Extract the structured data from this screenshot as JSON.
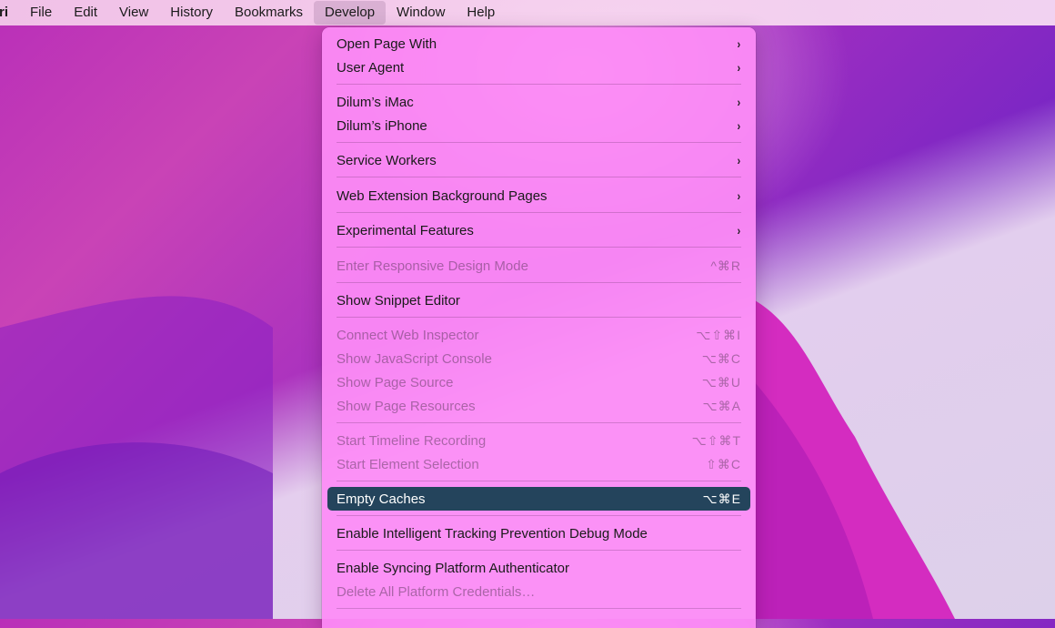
{
  "menubar": {
    "items": [
      "ri",
      "File",
      "Edit",
      "View",
      "History",
      "Bookmarks",
      "Develop",
      "Window",
      "Help"
    ]
  },
  "menu": {
    "items": {
      "open_page_with": {
        "label": "Open Page With",
        "shortcut": "›"
      },
      "user_agent": {
        "label": "User Agent",
        "shortcut": "›"
      },
      "imac": {
        "label": "Dilum’s iMac",
        "shortcut": "›"
      },
      "iphone": {
        "label": "Dilum’s iPhone",
        "shortcut": "›"
      },
      "service_workers": {
        "label": "Service Workers",
        "shortcut": "›"
      },
      "web_ext_bg": {
        "label": "Web Extension Background Pages",
        "shortcut": "›"
      },
      "experimental": {
        "label": "Experimental Features",
        "shortcut": "›"
      },
      "responsive": {
        "label": "Enter Responsive Design Mode",
        "shortcut": "^⌘R"
      },
      "snippet": {
        "label": "Show Snippet Editor",
        "shortcut": ""
      },
      "connect_inspector": {
        "label": "Connect Web Inspector",
        "shortcut": "⌥⇧⌘I"
      },
      "js_console": {
        "label": "Show JavaScript Console",
        "shortcut": "⌥⌘C"
      },
      "page_source": {
        "label": "Show Page Source",
        "shortcut": "⌥⌘U"
      },
      "page_resources": {
        "label": "Show Page Resources",
        "shortcut": "⌥⌘A"
      },
      "timeline": {
        "label": "Start Timeline Recording",
        "shortcut": "⌥⇧⌘T"
      },
      "element_selection": {
        "label": "Start Element Selection",
        "shortcut": "⇧⌘C"
      },
      "empty_caches": {
        "label": "Empty Caches",
        "shortcut": "⌥⌘E"
      },
      "itp_debug": {
        "label": "Enable Intelligent Tracking Prevention Debug Mode",
        "shortcut": ""
      },
      "syncing_auth": {
        "label": "Enable Syncing Platform Authenticator",
        "shortcut": ""
      },
      "delete_credentials": {
        "label": "Delete All Platform Credentials…",
        "shortcut": ""
      }
    }
  },
  "colors": {
    "selected_bg": "#24445c",
    "menu_bg": "#fd8cf6"
  }
}
